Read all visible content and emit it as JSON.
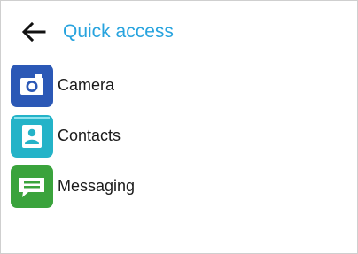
{
  "header": {
    "back_icon": "arrow-left-icon",
    "title": "Quick access",
    "accent_color": "#27a3de"
  },
  "items": [
    {
      "label": "Camera",
      "icon": "camera-icon",
      "icon_color": "#2b58b6"
    },
    {
      "label": "Contacts",
      "icon": "contacts-icon",
      "icon_color": "#24b3c8"
    },
    {
      "label": "Messaging",
      "icon": "messaging-icon",
      "icon_color": "#3aa33c"
    }
  ]
}
